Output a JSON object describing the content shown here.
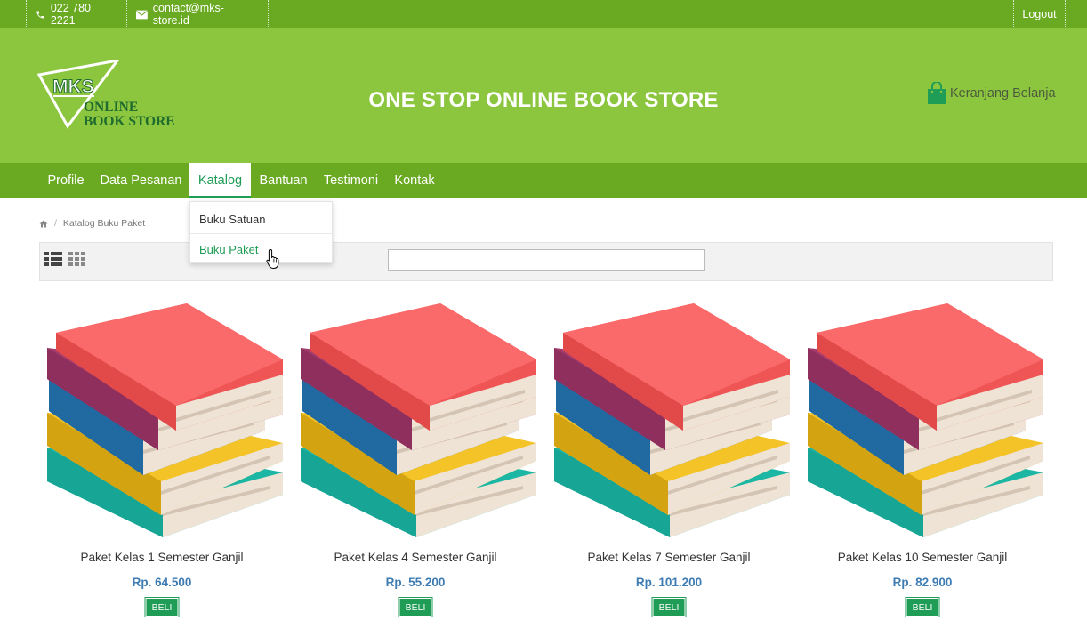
{
  "topbar": {
    "phone": "022 780 2221",
    "email": "contact@mks-store.id",
    "logout": "Logout"
  },
  "header": {
    "logo_main": "MKS",
    "logo_line1": "ONLINE",
    "logo_line2": "BOOK STORE",
    "tagline": "ONE STOP ONLINE BOOK STORE",
    "cart_label": "Keranjang Belanja"
  },
  "nav": {
    "items": [
      {
        "label": "Profile"
      },
      {
        "label": "Data Pesanan"
      },
      {
        "label": "Katalog"
      },
      {
        "label": "Bantuan"
      },
      {
        "label": "Testimoni"
      },
      {
        "label": "Kontak"
      }
    ],
    "active": "Katalog",
    "dropdown": [
      {
        "label": "Buku Satuan"
      },
      {
        "label": "Buku Paket"
      }
    ]
  },
  "breadcrumb": {
    "current": "Katalog Buku Paket"
  },
  "toolbar": {
    "search_value": "",
    "search_placeholder": ""
  },
  "products": [
    {
      "name": "Paket Kelas 1 Semester Ganjil",
      "price": "Rp. 64.500",
      "button": "BELI"
    },
    {
      "name": "Paket Kelas 4 Semester Ganjil",
      "price": "Rp. 55.200",
      "button": "BELI"
    },
    {
      "name": "Paket Kelas 7 Semester Ganjil",
      "price": "Rp. 101.200",
      "button": "BELI"
    },
    {
      "name": "Paket Kelas 10 Semester Ganjil",
      "price": "Rp. 82.900",
      "button": "BELI"
    }
  ],
  "colors": {
    "topbar": "#6aaa22",
    "header": "#8cc63f",
    "accent_green": "#1f9c55",
    "price_blue": "#3d7bb3"
  },
  "icons": [
    "phone-icon",
    "envelope-icon",
    "shopping-bag-icon",
    "home-icon",
    "list-view-icon",
    "grid-view-icon",
    "hand-pointer-icon"
  ]
}
